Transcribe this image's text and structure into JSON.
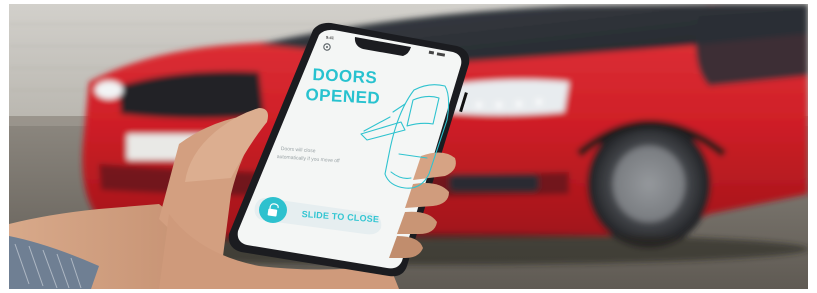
{
  "photo": {
    "description_kind": "product-photo",
    "phone_screen": {
      "status_time": "9:41",
      "title_line1": "DOORS",
      "title_line2": "OPENED",
      "info_line1": "Doors will close",
      "info_line2": "automatically if you move off",
      "slide_button_label": "SLIDE TO CLOSE",
      "slide_button_icon": "unlock-icon",
      "settings_icon": "gear-icon",
      "illustration_icon": "car-outline-open-door-icon"
    },
    "colors": {
      "accent": "#28c2cf",
      "car_body": "#d8232a",
      "screen_bg": "#f4f6f5"
    }
  }
}
